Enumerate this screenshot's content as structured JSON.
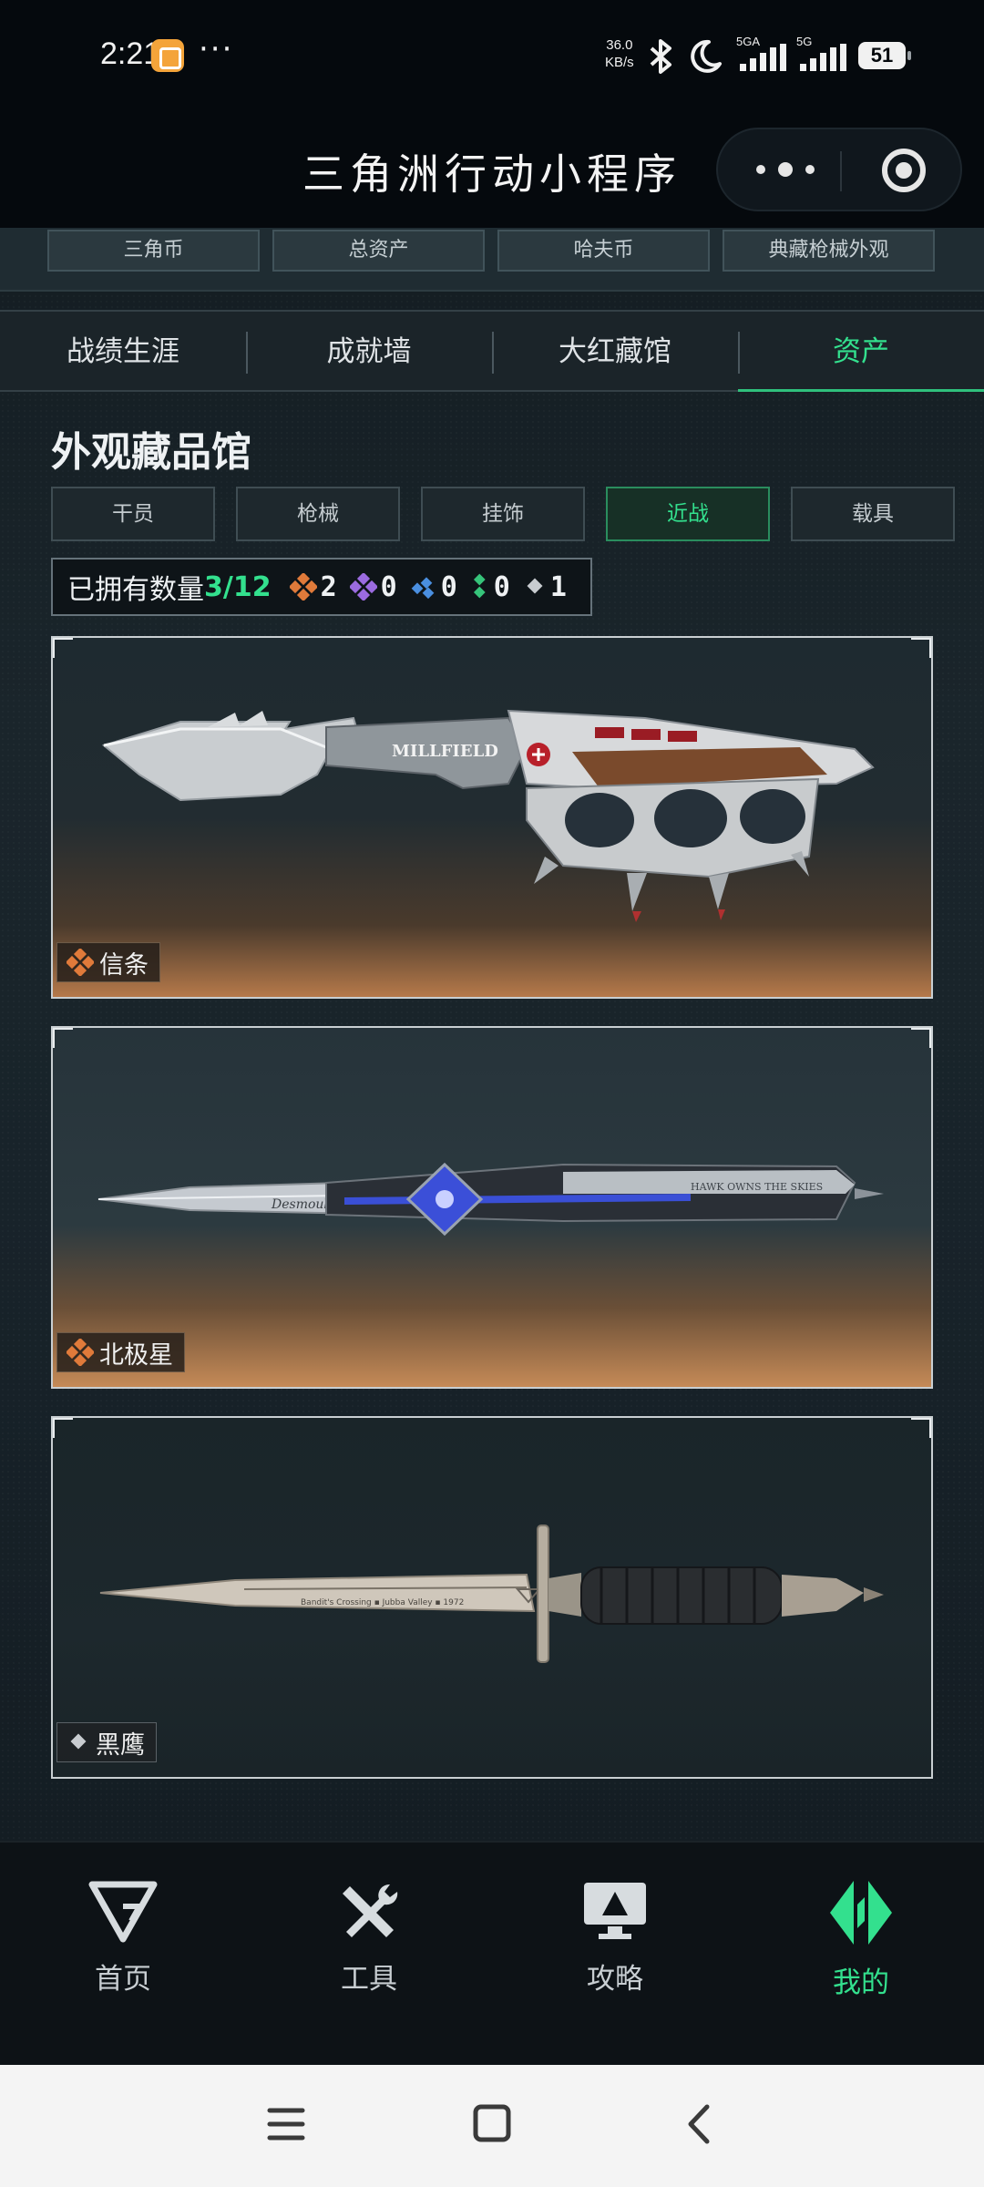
{
  "status_bar": {
    "time": "2:21",
    "more": "···",
    "speed_value": "36.0",
    "speed_unit": "KB/s",
    "net1": "5GA",
    "net2": "5G",
    "battery": "51"
  },
  "header": {
    "title": "三角洲行动小程序"
  },
  "asset_tabs": [
    "三角币",
    "总资产",
    "哈夫币",
    "典藏枪械外观"
  ],
  "main_tabs": [
    "战绩生涯",
    "成就墙",
    "大红藏馆",
    "资产"
  ],
  "main_tab_active": 3,
  "section_title": "外观藏品馆",
  "category_tabs": [
    "干员",
    "枪械",
    "挂饰",
    "近战",
    "载具"
  ],
  "category_active": 3,
  "owned": {
    "label": "已拥有数量",
    "fraction": "3/12",
    "rarity_counts": [
      "2",
      "0",
      "0",
      "0",
      "1"
    ],
    "rarity_colors": [
      "#e07a3a",
      "#9b6be0",
      "#4a8fe0",
      "#36c47a",
      "#c8ccd0"
    ]
  },
  "items": [
    {
      "name": "信条",
      "rarity_color": "#e07a3a",
      "blade_text": "MILLFIELD"
    },
    {
      "name": "北极星",
      "rarity_color": "#e07a3a",
      "blade_text": "Desmoulins",
      "handle_text": "HAWK OWNS THE SKIES"
    },
    {
      "name": "黑鹰",
      "rarity_color": "#c8ccd0",
      "blade_text": "Bandit's Crossing ▪ Jubba Valley ▪ 1972"
    }
  ],
  "bottom_nav": [
    "首页",
    "工具",
    "攻略",
    "我的"
  ],
  "bottom_nav_active": 3
}
